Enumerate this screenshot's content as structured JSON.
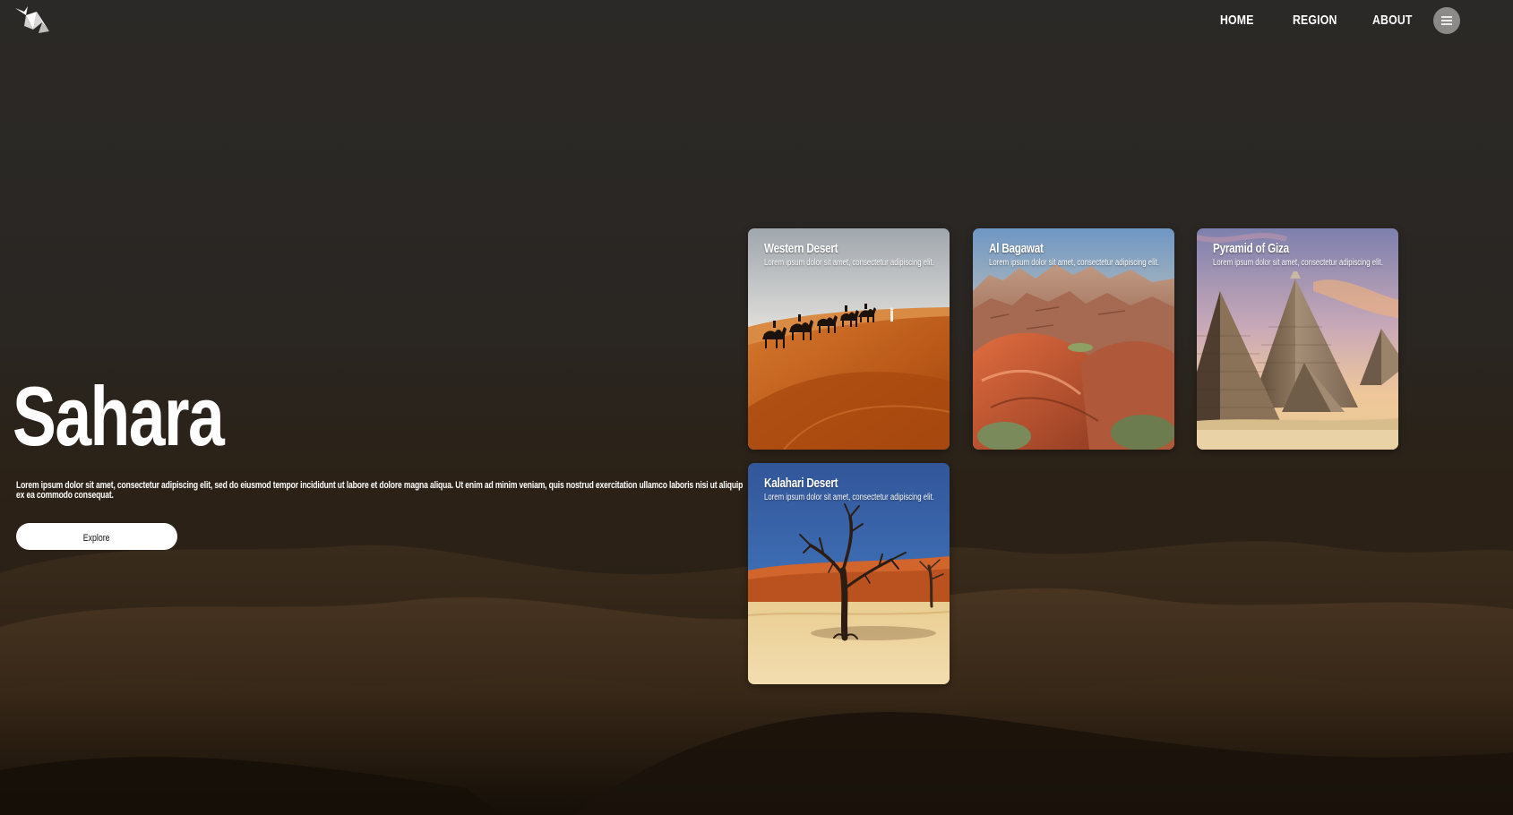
{
  "header": {
    "logo_icon": "origami-bird-logo-icon",
    "nav": [
      {
        "label": "HOME"
      },
      {
        "label": "REGION"
      },
      {
        "label": "ABOUT"
      }
    ],
    "menu_icon": "hamburger-menu-icon"
  },
  "hero": {
    "title": "Sahara",
    "description": "Lorem ipsum dolor sit amet, consectetur adipiscing elit, sed do eiusmod tempor incididunt ut labore et dolore magna aliqua. Ut enim ad minim veniam, quis nostrud exercitation ullamco laboris nisi ut aliquip ex ea commodo consequat.",
    "button_label": "Explore"
  },
  "cards": [
    {
      "title": "Western Desert",
      "description": "Lorem ipsum dolor sit amet, consectetur adipiscing elit."
    },
    {
      "title": "Al Bagawat",
      "description": "Lorem ipsum dolor sit amet, consectetur adipiscing elit."
    },
    {
      "title": "Pyramid of Giza",
      "description": "Lorem ipsum dolor sit amet, consectetur adipiscing elit."
    },
    {
      "title": "Kalahari Desert",
      "description": "Lorem ipsum dolor sit amet, consectetur adipiscing elit."
    }
  ],
  "colors": {
    "text": "#ffffff",
    "button_bg": "#ffffff",
    "menu_button_bg": "#8b8a89"
  }
}
